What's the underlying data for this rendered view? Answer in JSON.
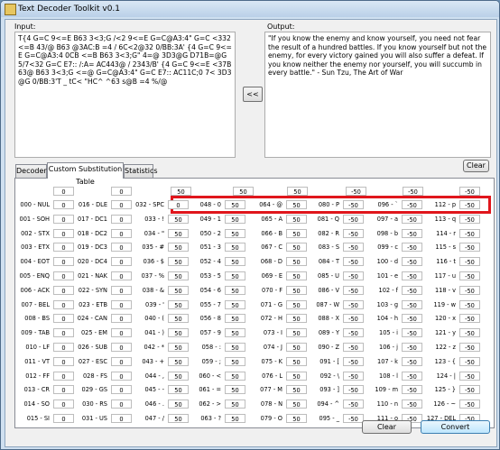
{
  "window": {
    "title": "Text Decoder Toolkit v0.1"
  },
  "input": {
    "label": "Input:",
    "text": "T{4 G=C 9<=E B63 3<3;G /<2 9<=E G=C@A3:4\" G=C <332 <=B 43/@ B63 @3AC:B =4 / 6C<2@32 0/BB:3A' {4 G=C 9<=E G=C@A3:4 0CB <=B B63 3<3;G\" 4=@ 3D3@G D71B=@G 5/7<32 G=C E7:: /:A= AC443@ / 2343/B' {4 G=C 9<=E <37B63@ B63 3<3;G <=@ G=C@A3:4\" G=C E7:: AC11C;0 7< 3D3@G 0/BB:3'T _ tC< \"HC^ ^63 s@B =4 %/@"
  },
  "output": {
    "label": "Output:",
    "text": "\"If you know the enemy and know yourself, you need not fear the result of a hundred battles. If you know yourself but not the enemy, for every victory gained you will also suffer a defeat. If you know neither the enemy nor yourself, you will succumb in every battle.\" - Sun Tzu, The Art of War"
  },
  "buttons": {
    "swap": "<<",
    "clear_top": "Clear",
    "clear_bottom": "Clear",
    "convert": "Convert"
  },
  "tabs": [
    "Decoder",
    "Custom Substitution Table",
    "Statistics"
  ],
  "active_tab": 1,
  "top_row": [
    "0",
    "0",
    "50",
    "50",
    "50",
    "-50",
    "-50",
    "-50"
  ],
  "columns": [
    [
      [
        "000 - NUL",
        "0"
      ],
      [
        "001 - SOH",
        "0"
      ],
      [
        "002 - STX",
        "0"
      ],
      [
        "003 - ETX",
        "0"
      ],
      [
        "004 - EOT",
        "0"
      ],
      [
        "005 - ENQ",
        "0"
      ],
      [
        "006 - ACK",
        "0"
      ],
      [
        "007 - BEL",
        "0"
      ],
      [
        "008 - BS",
        "0"
      ],
      [
        "009 - TAB",
        "0"
      ],
      [
        "010 - LF",
        "0"
      ],
      [
        "011 - VT",
        "0"
      ],
      [
        "012 - FF",
        "0"
      ],
      [
        "013 - CR",
        "0"
      ],
      [
        "014 - SO",
        "0"
      ],
      [
        "015 - SI",
        "0"
      ]
    ],
    [
      [
        "016 - DLE",
        "0"
      ],
      [
        "017 - DC1",
        "0"
      ],
      [
        "018 - DC2",
        "0"
      ],
      [
        "019 - DC3",
        "0"
      ],
      [
        "020 - DC4",
        "0"
      ],
      [
        "021 - NAK",
        "0"
      ],
      [
        "022 - SYN",
        "0"
      ],
      [
        "023 - ETB",
        "0"
      ],
      [
        "024 - CAN",
        "0"
      ],
      [
        "025 - EM",
        "0"
      ],
      [
        "026 - SUB",
        "0"
      ],
      [
        "027 - ESC",
        "0"
      ],
      [
        "028 - FS",
        "0"
      ],
      [
        "029 - GS",
        "0"
      ],
      [
        "030 - RS",
        "0"
      ],
      [
        "031 - US",
        "0"
      ]
    ],
    [
      [
        "032 - SPC",
        "0"
      ],
      [
        "033 - !",
        "50"
      ],
      [
        "034 - \"",
        "50"
      ],
      [
        "035 - #",
        "50"
      ],
      [
        "036 - $",
        "50"
      ],
      [
        "037 - %",
        "50"
      ],
      [
        "038 - &",
        "50"
      ],
      [
        "039 - '",
        "50"
      ],
      [
        "040 - (",
        "50"
      ],
      [
        "041 - )",
        "50"
      ],
      [
        "042 - *",
        "50"
      ],
      [
        "043 - +",
        "50"
      ],
      [
        "044 - ,",
        "50"
      ],
      [
        "045 - -",
        "50"
      ],
      [
        "046 - .",
        "50"
      ],
      [
        "047 - /",
        "50"
      ]
    ],
    [
      [
        "048 - 0",
        "50"
      ],
      [
        "049 - 1",
        "50"
      ],
      [
        "050 - 2",
        "50"
      ],
      [
        "051 - 3",
        "50"
      ],
      [
        "052 - 4",
        "50"
      ],
      [
        "053 - 5",
        "50"
      ],
      [
        "054 - 6",
        "50"
      ],
      [
        "055 - 7",
        "50"
      ],
      [
        "056 - 8",
        "50"
      ],
      [
        "057 - 9",
        "50"
      ],
      [
        "058 - :",
        "50"
      ],
      [
        "059 - ;",
        "50"
      ],
      [
        "060 - <",
        "50"
      ],
      [
        "061 - =",
        "50"
      ],
      [
        "062 - >",
        "50"
      ],
      [
        "063 - ?",
        "50"
      ]
    ],
    [
      [
        "064 - @",
        "50"
      ],
      [
        "065 - A",
        "50"
      ],
      [
        "066 - B",
        "50"
      ],
      [
        "067 - C",
        "50"
      ],
      [
        "068 - D",
        "50"
      ],
      [
        "069 - E",
        "50"
      ],
      [
        "070 - F",
        "50"
      ],
      [
        "071 - G",
        "50"
      ],
      [
        "072 - H",
        "50"
      ],
      [
        "073 - I",
        "50"
      ],
      [
        "074 - J",
        "50"
      ],
      [
        "075 - K",
        "50"
      ],
      [
        "076 - L",
        "50"
      ],
      [
        "077 - M",
        "50"
      ],
      [
        "078 - N",
        "50"
      ],
      [
        "079 - O",
        "50"
      ]
    ],
    [
      [
        "080 - P",
        "-50"
      ],
      [
        "081 - Q",
        "-50"
      ],
      [
        "082 - R",
        "-50"
      ],
      [
        "083 - S",
        "-50"
      ],
      [
        "084 - T",
        "-50"
      ],
      [
        "085 - U",
        "-50"
      ],
      [
        "086 - V",
        "-50"
      ],
      [
        "087 - W",
        "-50"
      ],
      [
        "088 - X",
        "-50"
      ],
      [
        "089 - Y",
        "-50"
      ],
      [
        "090 - Z",
        "-50"
      ],
      [
        "091 - [",
        "-50"
      ],
      [
        "092 - \\",
        "-50"
      ],
      [
        "093 - ]",
        "-50"
      ],
      [
        "094 - ^",
        "-50"
      ],
      [
        "095 - _",
        "-50"
      ]
    ],
    [
      [
        "096 - `",
        "-50"
      ],
      [
        "097 - a",
        "-50"
      ],
      [
        "098 - b",
        "-50"
      ],
      [
        "099 - c",
        "-50"
      ],
      [
        "100 - d",
        "-50"
      ],
      [
        "101 - e",
        "-50"
      ],
      [
        "102 - f",
        "-50"
      ],
      [
        "103 - g",
        "-50"
      ],
      [
        "104 - h",
        "-50"
      ],
      [
        "105 - i",
        "-50"
      ],
      [
        "106 - j",
        "-50"
      ],
      [
        "107 - k",
        "-50"
      ],
      [
        "108 - l",
        "-50"
      ],
      [
        "109 - m",
        "-50"
      ],
      [
        "110 - n",
        "-50"
      ],
      [
        "111 - o",
        "-50"
      ]
    ],
    [
      [
        "112 - p",
        "-50"
      ],
      [
        "113 - q",
        "-50"
      ],
      [
        "114 - r",
        "-50"
      ],
      [
        "115 - s",
        "-50"
      ],
      [
        "116 - t",
        "-50"
      ],
      [
        "117 - u",
        "-50"
      ],
      [
        "118 - v",
        "-50"
      ],
      [
        "119 - w",
        "-50"
      ],
      [
        "120 - x",
        "-50"
      ],
      [
        "121 - y",
        "-50"
      ],
      [
        "122 - z",
        "-50"
      ],
      [
        "123 - {",
        "-50"
      ],
      [
        "124 - |",
        "-50"
      ],
      [
        "125 - }",
        "-50"
      ],
      [
        "126 - ~",
        "-50"
      ],
      [
        "127 - DEL",
        "-50"
      ]
    ]
  ],
  "colors": {
    "highlight": "#e0161c",
    "title_bar": "#b9d0e8",
    "convert_button": "#bee6fd"
  }
}
